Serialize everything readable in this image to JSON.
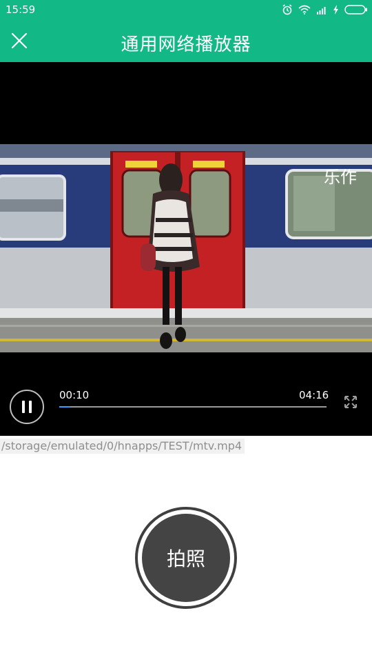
{
  "status_bar": {
    "time": "15:59",
    "icons": [
      "alarm-icon",
      "wifi-icon",
      "signal-icon",
      "charging-icon",
      "battery-icon"
    ]
  },
  "app_bar": {
    "title": "通用网络播放器",
    "close_icon": "close-icon"
  },
  "player": {
    "current_time": "00:10",
    "total_time": "04:16",
    "progress": 0.04,
    "pause_icon": "pause-icon",
    "fullscreen_icon": "fullscreen-icon",
    "logo_text": "乐作"
  },
  "file_path": "/storage/emulated/0/hnapps/TEST/mtv.mp4",
  "capture_button": {
    "label": "拍照"
  },
  "colors": {
    "appbar": "#12b886",
    "player_bg": "#000000",
    "progress_fill": "#3aa0ff",
    "capture_bg": "#444444"
  }
}
